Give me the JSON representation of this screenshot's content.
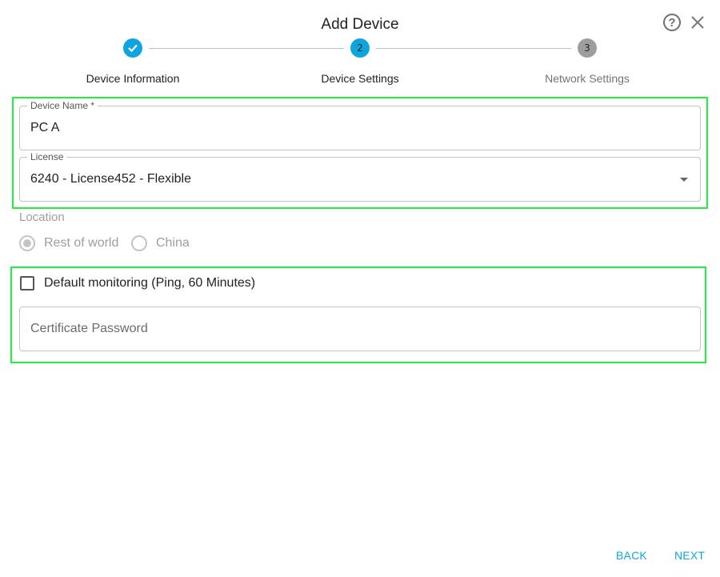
{
  "dialog": {
    "title": "Add Device",
    "help_icon": "help-circle-icon",
    "close_icon": "close-icon"
  },
  "stepper": {
    "steps": [
      {
        "number": "1",
        "label": "Device Information",
        "state": "completed",
        "icon": "check-icon"
      },
      {
        "number": "2",
        "label": "Device Settings",
        "state": "active"
      },
      {
        "number": "3",
        "label": "Network Settings",
        "state": "inactive"
      }
    ],
    "colors": {
      "active": "#0ea5df",
      "inactive": "#9e9e9e"
    }
  },
  "form": {
    "device_name": {
      "label": "Device Name *",
      "value": "PC A"
    },
    "license": {
      "label": "License",
      "value": "6240 - License452 - Flexible"
    },
    "location": {
      "label": "Location",
      "options": [
        {
          "label": "Rest of world",
          "selected": true
        },
        {
          "label": "China",
          "selected": false
        }
      ],
      "disabled": true
    },
    "default_monitoring": {
      "label": "Default monitoring (Ping, 60 Minutes)",
      "checked": false
    },
    "certificate_password": {
      "placeholder": "Certificate Password",
      "value": ""
    }
  },
  "footer": {
    "back_label": "BACK",
    "next_label": "NEXT"
  },
  "highlight_color": "#22f03a"
}
